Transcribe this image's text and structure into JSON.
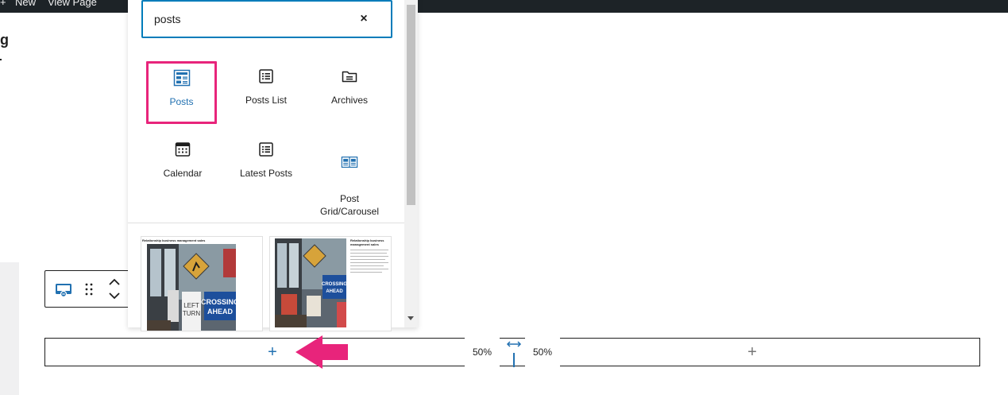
{
  "admin_bar": {
    "plus_glyph": "+",
    "new_label": "New",
    "view_page_label": "View Page"
  },
  "editor": {
    "left_edge_char": "g"
  },
  "inserter": {
    "search": {
      "value": "posts"
    },
    "clear_glyph": "×",
    "blocks": [
      {
        "label": "Posts",
        "icon": "posts-block-icon",
        "selected": true
      },
      {
        "label": "Posts List",
        "icon": "list-icon"
      },
      {
        "label": "Archives",
        "icon": "folder-icon"
      },
      {
        "label": "Calendar",
        "icon": "calendar-icon"
      },
      {
        "label": "Latest Posts",
        "icon": "list-icon"
      },
      {
        "label": "Post\nGrid/Carousel",
        "icon": "grid-carousel-icon"
      }
    ],
    "previews": [
      {
        "title": "Relationship business management sales"
      },
      {
        "title": "Relationship business management sales"
      }
    ]
  },
  "block_toolbar": {
    "icons": [
      "columns-block-icon",
      "drag-handle-icon",
      "chevron-up-icon",
      "chevron-down-icon"
    ]
  },
  "columns": {
    "add_glyph": "+",
    "left_width": "50%",
    "right_width": "50%"
  },
  "colors": {
    "accent": "#007cba",
    "highlight": "#e8247b",
    "admin_bar": "#1d2327"
  }
}
